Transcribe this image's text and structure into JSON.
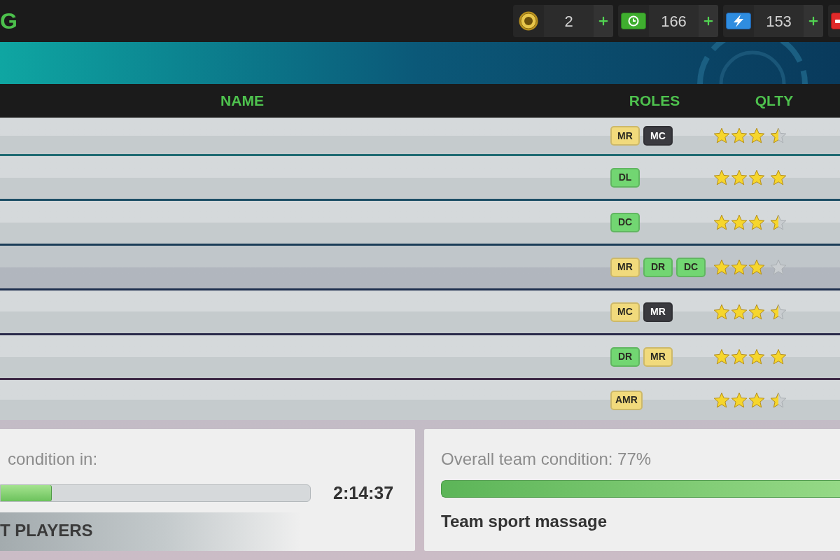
{
  "title": {
    "text": "G"
  },
  "currencies": [
    {
      "kind": "coin",
      "value": "2"
    },
    {
      "kind": "banknote",
      "value": "166"
    },
    {
      "kind": "bolt",
      "value": "153"
    },
    {
      "kind": "tile"
    }
  ],
  "table": {
    "columns": [
      "NAME",
      "ROLES",
      "QLTY"
    ],
    "rows": [
      {
        "selected": false,
        "roles": [
          {
            "label": "MR",
            "color": "#f1da7c"
          },
          {
            "label": "MC",
            "color": "#3a3a3f"
          }
        ],
        "stars": 3.5
      },
      {
        "selected": false,
        "roles": [
          {
            "label": "DL",
            "color": "#72d672"
          }
        ],
        "stars": 4
      },
      {
        "selected": false,
        "roles": [
          {
            "label": "DC",
            "color": "#72d672"
          }
        ],
        "stars": 3.5
      },
      {
        "selected": true,
        "roles": [
          {
            "label": "MR",
            "color": "#f1da7c"
          },
          {
            "label": "DR",
            "color": "#72d672"
          },
          {
            "label": "DC",
            "color": "#72d672"
          }
        ],
        "stars": 3
      },
      {
        "selected": false,
        "roles": [
          {
            "label": "MC",
            "color": "#f1da7c"
          },
          {
            "label": "MR",
            "color": "#3a3a3f"
          }
        ],
        "stars": 3.5
      },
      {
        "selected": false,
        "roles": [
          {
            "label": "DR",
            "color": "#72d672"
          },
          {
            "label": "MR",
            "color": "#f1da7c"
          }
        ],
        "stars": 4
      },
      {
        "selected": false,
        "roles": [
          {
            "label": "AMR",
            "color": "#f1da7c"
          }
        ],
        "stars": 3.5
      }
    ]
  },
  "recovery_panel": {
    "label": "condition in:",
    "level": 0.165,
    "timer": "2:14:37",
    "button": "T PLAYERS"
  },
  "team_panel": {
    "label": "Overall team condition: 77%",
    "level": 1,
    "button": "Team sport massage"
  }
}
